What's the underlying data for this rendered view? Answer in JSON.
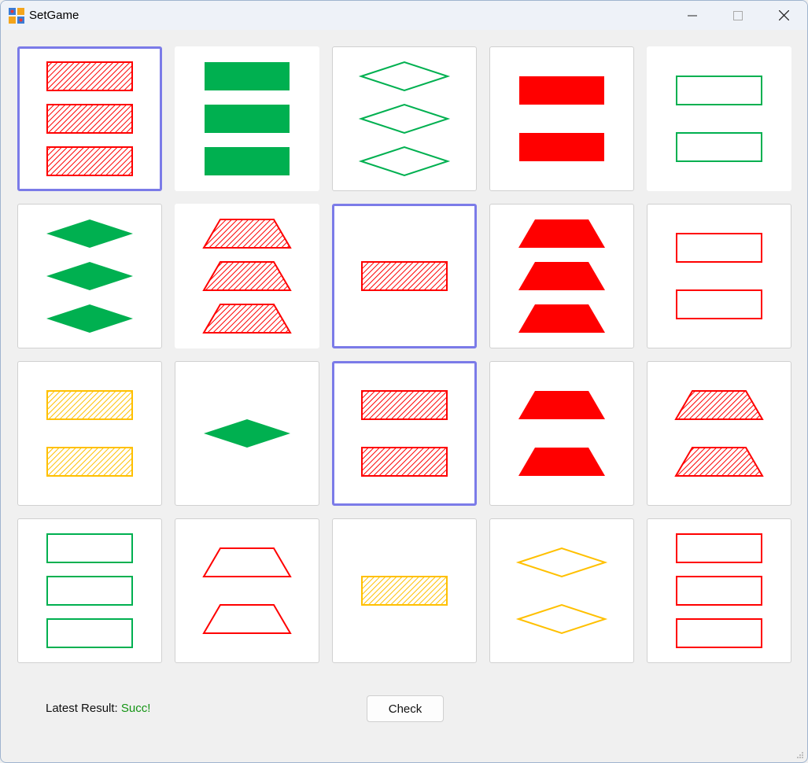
{
  "window": {
    "title": "SetGame"
  },
  "titlebar_icons": [
    "app-icon",
    "minimize-icon",
    "maximize-icon",
    "close-icon"
  ],
  "colors": {
    "red": "#ff0000",
    "green": "#00b050",
    "yellow": "#ffc000",
    "selection": "#7b7be8",
    "result": "#149414"
  },
  "cards": [
    {
      "number": 3,
      "shape": "rectangle",
      "color": "red",
      "fill": "striped",
      "selected": true
    },
    {
      "number": 3,
      "shape": "rectangle",
      "color": "green",
      "fill": "solid",
      "selected": false
    },
    {
      "number": 3,
      "shape": "diamond",
      "color": "green",
      "fill": "outline",
      "selected": false
    },
    {
      "number": 2,
      "shape": "rectangle",
      "color": "red",
      "fill": "solid",
      "selected": false
    },
    {
      "number": 2,
      "shape": "rectangle",
      "color": "green",
      "fill": "outline",
      "selected": false
    },
    {
      "number": 3,
      "shape": "diamond",
      "color": "green",
      "fill": "solid",
      "selected": false
    },
    {
      "number": 3,
      "shape": "trapezoid",
      "color": "red",
      "fill": "striped",
      "selected": false
    },
    {
      "number": 1,
      "shape": "rectangle",
      "color": "red",
      "fill": "striped",
      "selected": true
    },
    {
      "number": 3,
      "shape": "trapezoid",
      "color": "red",
      "fill": "solid",
      "selected": false
    },
    {
      "number": 2,
      "shape": "rectangle",
      "color": "red",
      "fill": "outline",
      "selected": false
    },
    {
      "number": 2,
      "shape": "rectangle",
      "color": "yellow",
      "fill": "striped",
      "selected": false
    },
    {
      "number": 1,
      "shape": "diamond",
      "color": "green",
      "fill": "solid",
      "selected": false
    },
    {
      "number": 2,
      "shape": "rectangle",
      "color": "red",
      "fill": "striped",
      "selected": true
    },
    {
      "number": 2,
      "shape": "trapezoid",
      "color": "red",
      "fill": "solid",
      "selected": false
    },
    {
      "number": 2,
      "shape": "trapezoid",
      "color": "red",
      "fill": "striped",
      "selected": false
    },
    {
      "number": 3,
      "shape": "rectangle",
      "color": "green",
      "fill": "outline",
      "selected": false
    },
    {
      "number": 2,
      "shape": "trapezoid",
      "color": "red",
      "fill": "outline",
      "selected": false
    },
    {
      "number": 1,
      "shape": "rectangle",
      "color": "yellow",
      "fill": "striped",
      "selected": false
    },
    {
      "number": 2,
      "shape": "diamond",
      "color": "yellow",
      "fill": "outline",
      "selected": false
    },
    {
      "number": 3,
      "shape": "rectangle",
      "color": "red",
      "fill": "outline",
      "selected": false
    }
  ],
  "footer": {
    "latest_result_label": "Latest Result:",
    "latest_result_value": "Succ!",
    "check_label": "Check"
  }
}
